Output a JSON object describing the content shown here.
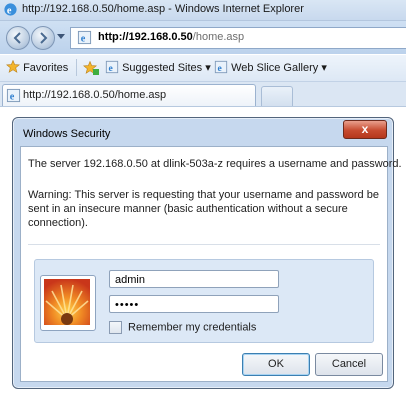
{
  "browser": {
    "window_title": "http://192.168.0.50/home.asp - Windows Internet Explorer",
    "address": {
      "host": "http://192.168.0.50",
      "path": "/home.asp"
    },
    "favorites_bar": {
      "favorites_label": "Favorites",
      "suggested_sites_label": "Suggested Sites ▾",
      "web_slice_label": "Web Slice Gallery ▾"
    },
    "tab": {
      "title": "http://192.168.0.50/home.asp"
    }
  },
  "dialog": {
    "title": "Windows Security",
    "close_label": "x",
    "message": "The server 192.168.0.50 at dlink-503a-z requires a username and password.",
    "warning": "Warning: This server is requesting that your username and password be sent in an insecure manner (basic authentication without a secure connection).",
    "username_value": "admin",
    "password_value": "•••••",
    "remember_label": "Remember my credentials",
    "remember_checked": false,
    "ok_label": "OK",
    "cancel_label": "Cancel"
  }
}
